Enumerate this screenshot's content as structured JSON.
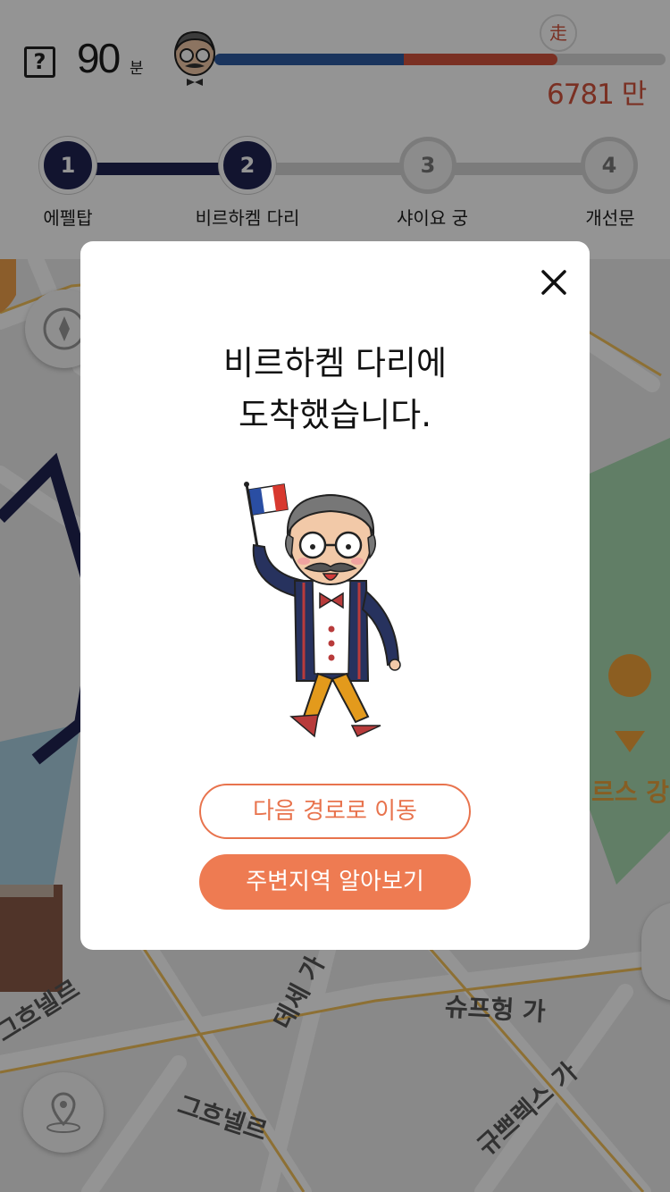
{
  "header": {
    "help_icon_glyph": "?",
    "time_value": "90",
    "time_unit": "분",
    "walk_marker_glyph": "走",
    "steps_count": "6781 만보",
    "progress": {
      "blue_fraction": 0.42,
      "red_fraction": 0.34
    },
    "colors": {
      "blue": "#2e5aa0",
      "red": "#d2533d"
    }
  },
  "route": {
    "stops": [
      {
        "number": "1",
        "label": "에펠탑",
        "status": "done"
      },
      {
        "number": "2",
        "label": "비르하켐 다리",
        "status": "done"
      },
      {
        "number": "3",
        "label": "샤이요 궁",
        "status": "todo"
      },
      {
        "number": "4",
        "label": "개선문",
        "status": "todo"
      }
    ],
    "colors": {
      "done": "#1f2451",
      "todo": "#d5d5d5"
    }
  },
  "map": {
    "streets": [
      "슈프헝 가",
      "데세 가",
      "그흐넬르",
      "규쁘렉스 가",
      "그흐넬르",
      "르스 강"
    ]
  },
  "modal": {
    "title_line1": "비르하켐 다리에",
    "title_line2": "도착했습니다.",
    "next_route_button": "다음 경로로 이동",
    "explore_button": "주변지역 알아보기",
    "accent_color": "#ee7b52"
  }
}
